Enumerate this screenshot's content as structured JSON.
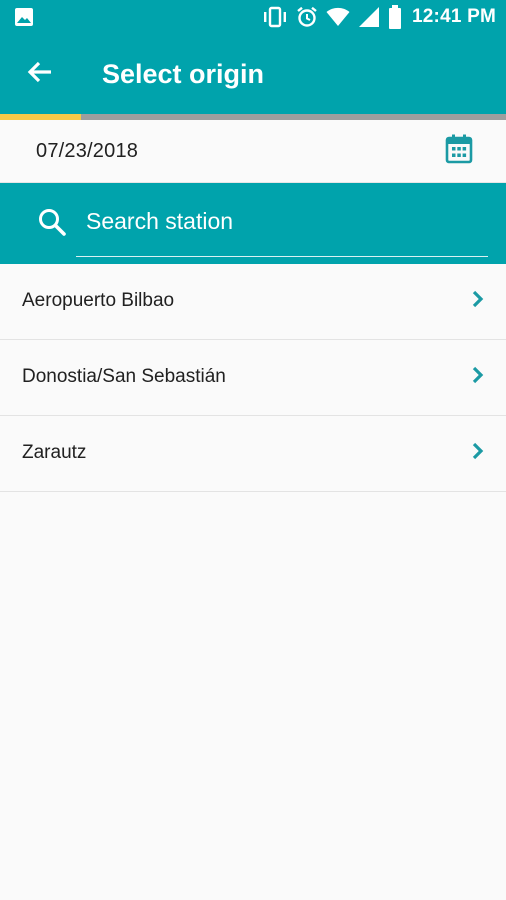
{
  "status_bar": {
    "time": "12:41 PM",
    "icons": [
      "image-icon",
      "vibrate-icon",
      "alarm-icon",
      "wifi-icon",
      "signal-icon",
      "battery-icon"
    ]
  },
  "toolbar": {
    "title": "Select origin",
    "back_icon": "arrow-left-icon"
  },
  "trip": {
    "date": "07/23/2018",
    "calendar_icon": "calendar-icon",
    "progress_fraction": 0.16
  },
  "search": {
    "placeholder": "Search station",
    "value": ""
  },
  "stations": [
    {
      "label": "Aeropuerto Bilbao"
    },
    {
      "label": "Donostia/San Sebastián"
    },
    {
      "label": "Zarautz"
    }
  ],
  "colors": {
    "primary": "#00a3ac",
    "accent": "#f7c948",
    "track": "#9e9e9e",
    "chevron": "#1b9aa4"
  }
}
